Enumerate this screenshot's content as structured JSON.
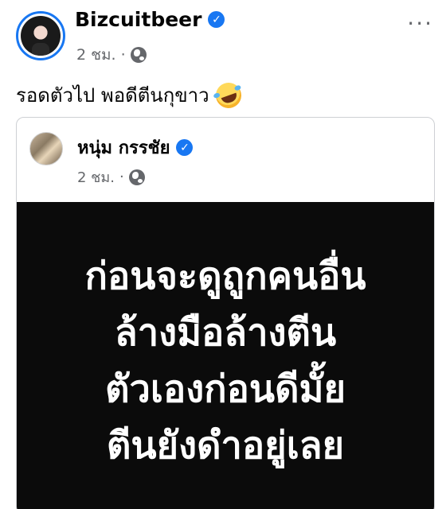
{
  "post": {
    "author": "Bizcuitbeer",
    "time": "2 ชม.",
    "dot": "·",
    "caption": "รอดตัวไป พอดีตีนกุขาว",
    "more": "···"
  },
  "shared_post": {
    "author": "หนุ่ม กรรชัย",
    "time": "2 ชม.",
    "dot": "·",
    "lines": [
      "ก่อนจะดูถูกคนอื่น",
      "ล้างมือล้างตีน",
      "ตัวเองก่อนดีมั้ย",
      "ตีนยังดำอยู่เลย"
    ]
  },
  "icons": {
    "verified": "verified-badge-icon",
    "privacy": "globe-icon",
    "reaction": "rolling-laughing-emoji-icon"
  },
  "colors": {
    "verified": "#1877f2",
    "secondary_text": "#65676b",
    "card_background": "#0b0b0b",
    "card_text": "#ffffff"
  }
}
